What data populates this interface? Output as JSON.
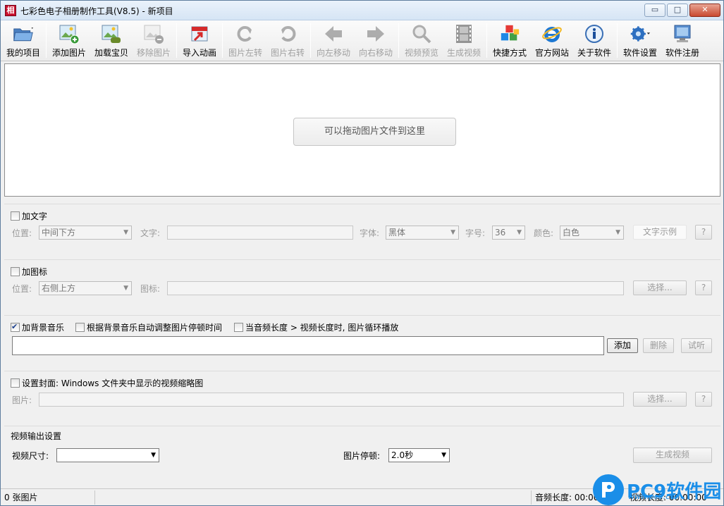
{
  "window": {
    "title": "七彩色电子相册制作工具(V8.5) - 新项目",
    "app_icon_glyph": "相",
    "minimize_glyph": "▭",
    "maximize_glyph": "□",
    "close_glyph": "✕"
  },
  "toolbar": {
    "my_project": "我的项目",
    "add_image": "添加图片",
    "load_baby": "加载宝贝",
    "remove_image": "移除图片",
    "import_animation": "导入动画",
    "rotate_left": "图片左转",
    "rotate_right": "图片右转",
    "move_left": "向左移动",
    "move_right": "向右移动",
    "video_preview": "视频预览",
    "generate_video": "生成视频",
    "shortcut": "快捷方式",
    "official_site": "官方网站",
    "about": "关于软件",
    "settings": "软件设置",
    "register": "软件注册"
  },
  "drop_area": {
    "hint": "可以拖动图片文件到这里"
  },
  "text_group": {
    "title": "加文字",
    "position_label": "位置:",
    "position_value": "中间下方",
    "text_label": "文字:",
    "font_label": "字体:",
    "font_value": "黑体",
    "size_label": "字号:",
    "size_value": "36",
    "color_label": "颜色:",
    "color_value": "白色",
    "sample_button": "文字示例",
    "help": "?"
  },
  "icon_group": {
    "title": "加图标",
    "position_label": "位置:",
    "position_value": "右侧上方",
    "icon_label": "图标:",
    "select_button": "选择...",
    "help": "?"
  },
  "music_group": {
    "bg_music": "加背景音乐",
    "auto_adjust": "根据背景音乐自动调整图片停顿时间",
    "loop_option": "当音频长度 > 视频长度时, 图片循环播放",
    "add_button": "添加",
    "delete_button": "删除",
    "listen_button": "试听"
  },
  "cover_group": {
    "title": "设置封面: Windows 文件夹中显示的视频缩略图",
    "image_label": "图片:",
    "select_button": "选择...",
    "help": "?"
  },
  "output_group": {
    "title": "视频输出设置",
    "size_label": "视频尺寸:",
    "size_value": "",
    "pause_label": "图片停顿:",
    "pause_value": "2.0秒",
    "generate_button": "生成视频"
  },
  "statusbar": {
    "image_count": "0 张图片",
    "audio_length": "音频长度: 00:00",
    "video_length": "视频长度: 00:00:00"
  },
  "watermark": {
    "brand": "PC9软件园",
    "domain": "www.pc9.com"
  },
  "colors": {
    "accent": "#1a8ee8",
    "title_bar": "#d6e5f5",
    "close_button": "#c94a31"
  }
}
